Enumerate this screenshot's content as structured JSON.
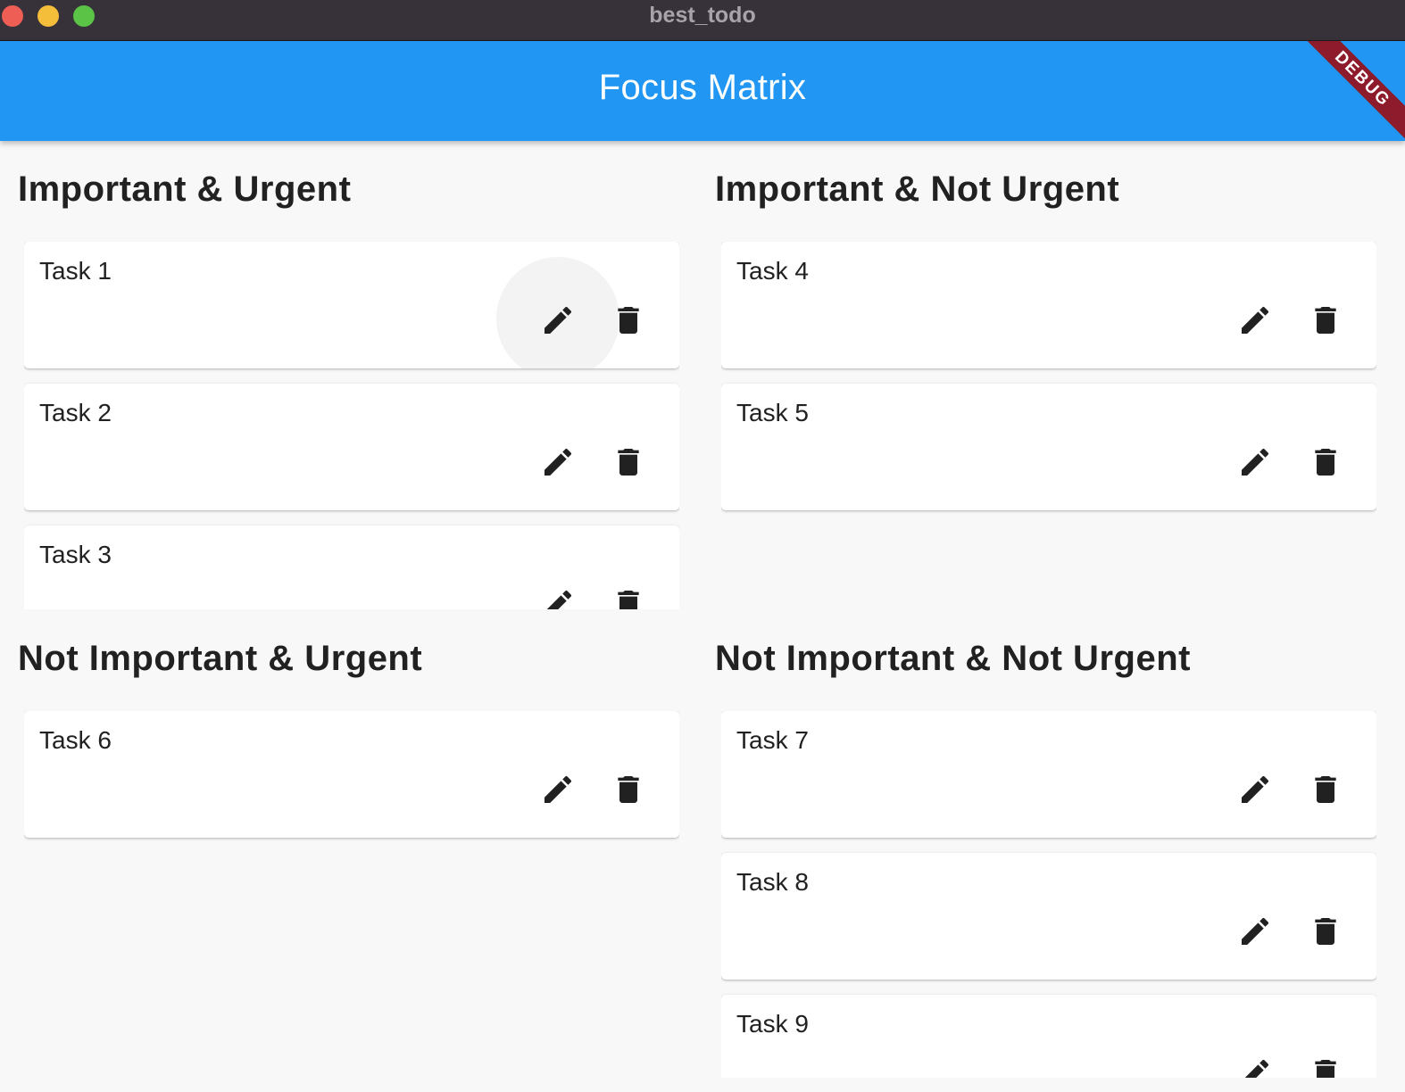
{
  "window": {
    "title": "best_todo"
  },
  "appbar": {
    "title": "Focus Matrix",
    "debug_banner": "DEBUG",
    "color": "#2196f3"
  },
  "quadrants": [
    {
      "title": "Important & Urgent",
      "tasks": [
        {
          "title": "Task 1"
        },
        {
          "title": "Task 2"
        },
        {
          "title": "Task 3"
        }
      ]
    },
    {
      "title": "Important & Not Urgent",
      "tasks": [
        {
          "title": "Task 4"
        },
        {
          "title": "Task 5"
        }
      ]
    },
    {
      "title": "Not Important & Urgent",
      "tasks": [
        {
          "title": "Task 6"
        }
      ]
    },
    {
      "title": "Not Important & Not Urgent",
      "tasks": [
        {
          "title": "Task 7"
        },
        {
          "title": "Task 8"
        },
        {
          "title": "Task 9"
        }
      ]
    }
  ],
  "icons": {
    "edit": "edit-pencil-icon",
    "delete": "delete-trash-icon"
  }
}
